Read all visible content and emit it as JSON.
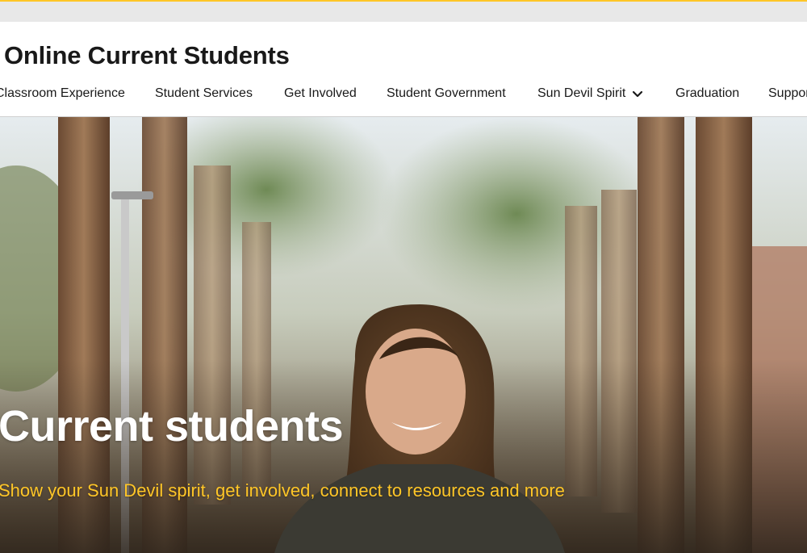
{
  "header": {
    "site_title": "Online Current Students"
  },
  "nav": {
    "items": [
      {
        "label": "Classroom Experience"
      },
      {
        "label": "Student Services"
      },
      {
        "label": "Get Involved"
      },
      {
        "label": "Student Government"
      },
      {
        "label": "Sun Devil Spirit",
        "icon": "chevron-down-icon"
      },
      {
        "label": "Graduation"
      },
      {
        "label": "Support"
      }
    ]
  },
  "hero": {
    "title": "Current students",
    "subtitle": "Show your Sun Devil spirit, get involved, connect to resources and more"
  },
  "colors": {
    "accent": "#ffc627",
    "text": "#191919",
    "hero_title": "#ffffff"
  }
}
